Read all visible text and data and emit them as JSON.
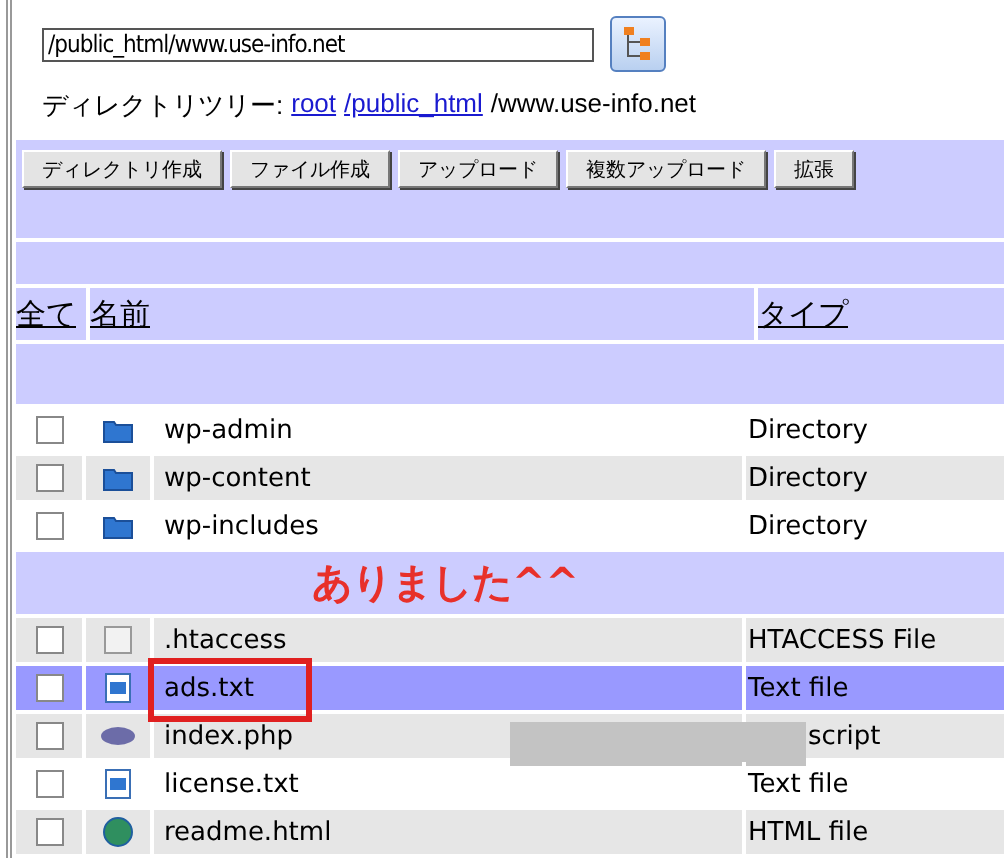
{
  "path_field": {
    "value": "/public_html/www.use-info.net"
  },
  "breadcrumb": {
    "label": "ディレクトリツリー:",
    "links": [
      "root",
      "/public_html"
    ],
    "current": "/www.use-info.net"
  },
  "toolbar": [
    "ディレクトリ作成",
    "ファイル作成",
    "アップロード",
    "複数アップロード",
    "拡張"
  ],
  "columns": [
    "全て",
    "名前",
    "タイプ"
  ],
  "directories": [
    {
      "name": "wp-admin",
      "type": "Directory",
      "kind": "folder",
      "checked": false,
      "selected": false,
      "shaded": false
    },
    {
      "name": "wp-content",
      "type": "Directory",
      "kind": "folder",
      "checked": false,
      "selected": false,
      "shaded": true
    },
    {
      "name": "wp-includes",
      "type": "Directory",
      "kind": "folder",
      "checked": false,
      "selected": false,
      "shaded": false
    }
  ],
  "files": [
    {
      "name": ".htaccess",
      "type": "HTACCESS File",
      "kind": "blank",
      "checked": false,
      "selected": false,
      "shaded": true
    },
    {
      "name": "ads.txt",
      "type": "Text file",
      "kind": "text",
      "checked": false,
      "selected": true,
      "shaded": false
    },
    {
      "name": "index.php",
      "type": "script",
      "kind": "php",
      "checked": false,
      "selected": false,
      "shaded": true,
      "redacted": true
    },
    {
      "name": "license.txt",
      "type": "Text file",
      "kind": "text",
      "checked": false,
      "selected": false,
      "shaded": false
    },
    {
      "name": "readme.html",
      "type": "HTML file",
      "kind": "html",
      "checked": false,
      "selected": false,
      "shaded": true
    }
  ],
  "annotation": {
    "text": "ありました^^"
  }
}
